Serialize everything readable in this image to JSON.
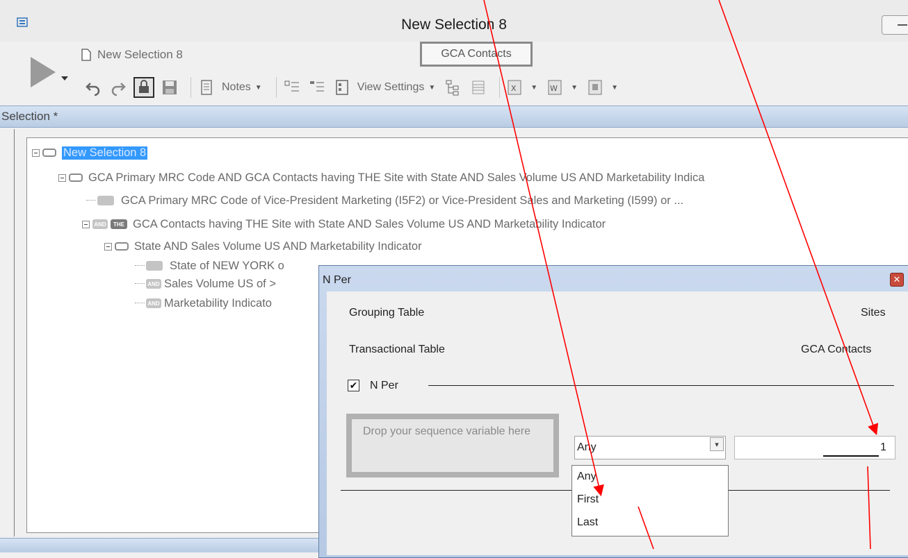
{
  "window": {
    "title": "New Selection 8"
  },
  "ribbon": {
    "doc_name": "New Selection 8",
    "table_chip": "GCA Contacts",
    "notes_label": "Notes",
    "view_settings_label": "View Settings"
  },
  "selection_pane": {
    "title": "Selection *",
    "tree": [
      {
        "label": "New Selection 8"
      },
      {
        "label": "GCA Primary MRC Code AND GCA Contacts having THE Site with State AND Sales Volume US AND Marketability Indica"
      },
      {
        "label": "GCA Primary MRC Code of Vice-President Marketing (I5F2) or Vice-President Sales and Marketing (I599) or ..."
      },
      {
        "label": "GCA Contacts having THE Site with State AND Sales Volume US AND Marketability Indicator"
      },
      {
        "label": "State AND Sales Volume US AND Marketability Indicator"
      },
      {
        "label": "State of NEW YORK o"
      },
      {
        "label": "Sales Volume US of >"
      },
      {
        "label": "Marketability Indicato"
      }
    ],
    "tags": {
      "and": "AND",
      "the": "THE"
    }
  },
  "dialog": {
    "title": "N Per",
    "close_glyph": "✕",
    "grouping_table_label": "Grouping Table",
    "grouping_table_value": "Sites",
    "transactional_table_label": "Transactional Table",
    "transactional_table_value": "GCA Contacts",
    "nper_checked_glyph": "✔",
    "nper_label": "N Per",
    "sequence_placeholder": "Drop your sequence variable here",
    "sequence_selected": "Any",
    "sequence_options": [
      "Any",
      "First",
      "Last"
    ],
    "count_value": "1"
  },
  "colors": {
    "annotation": "#ff0000",
    "highlight": "#3399ff"
  },
  "icons": [
    "app-icon",
    "play-icon",
    "document-icon",
    "undo-icon",
    "redo-icon",
    "lock-icon",
    "save-icon",
    "notes-icon",
    "add-node-icon",
    "remove-node-icon",
    "view-icon",
    "hierarchy-icon",
    "grid-icon",
    "export-excel-icon",
    "export-word-icon",
    "export-icon"
  ]
}
